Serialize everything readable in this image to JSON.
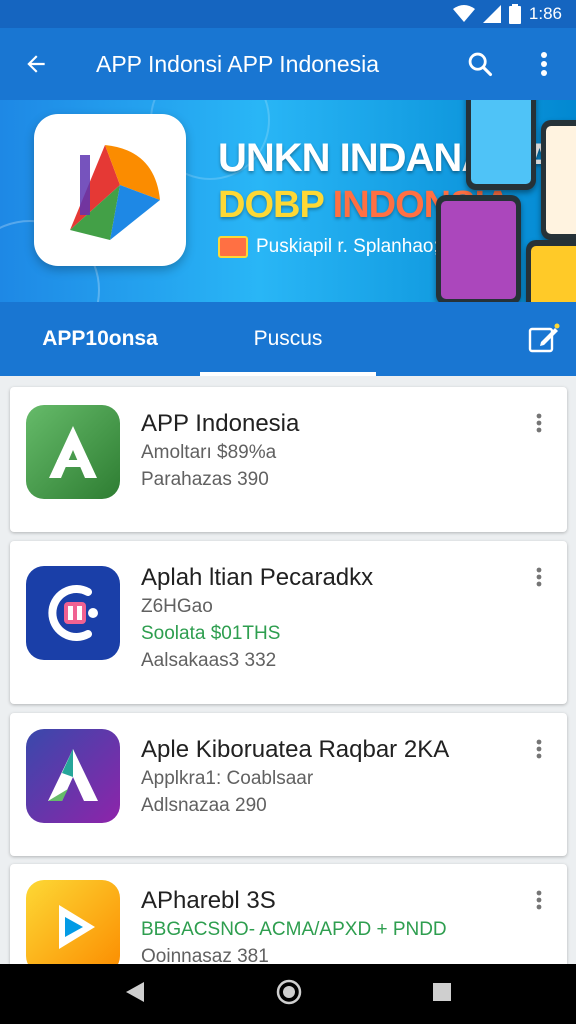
{
  "status": {
    "time": "1:86"
  },
  "app_bar": {
    "title": "APP Indonsi APP Indonesia"
  },
  "banner": {
    "headline": "UNKN INDANASIA",
    "headline2_a": "DOBP",
    "headline2_b": "INDONSIA",
    "subtitle": "Puskiapil r. Splanhao; Akbele"
  },
  "tabs": [
    {
      "label": "APP10onsa",
      "active": false
    },
    {
      "label": "Puscus",
      "active": true
    }
  ],
  "apps": [
    {
      "name": "APP Indonesia",
      "lines": [
        {
          "text": "Amoltarı $89%a",
          "style": "gray"
        },
        {
          "text": "Parahazas 390",
          "style": "gray"
        }
      ],
      "icon": "letter-a-icon",
      "icon_color": "#43a047"
    },
    {
      "name": "Aplah ltian Pecaradkx",
      "lines": [
        {
          "text": "Z6HGao",
          "style": "gray"
        },
        {
          "text": "Soolata $01THS",
          "style": "green"
        },
        {
          "text": "Aalsakaas3 332",
          "style": "gray"
        }
      ],
      "icon": "c-plug-icon",
      "icon_color": "#1a3fa8"
    },
    {
      "name": "Aple Kiboruatea Raqbar 2KA",
      "lines": [
        {
          "text": "Applkra1: Coablsaar",
          "style": "gray"
        },
        {
          "text": "Adlsnazaa 290",
          "style": "gray"
        }
      ],
      "icon": "triangle-a-icon",
      "icon_color": "#5e35b1"
    },
    {
      "name": "APharebl 3S",
      "lines": [
        {
          "text": "BBGACSNO- ACMA/APXD + PNDD",
          "style": "green"
        },
        {
          "text": "Ooinnasaz 381",
          "style": "gray"
        }
      ],
      "icon": "play-icon",
      "icon_color": "#fbc02d"
    }
  ],
  "colors": {
    "primary": "#1976d2",
    "primary_dark": "#1565c0",
    "accent_green": "#2e9e4f"
  }
}
